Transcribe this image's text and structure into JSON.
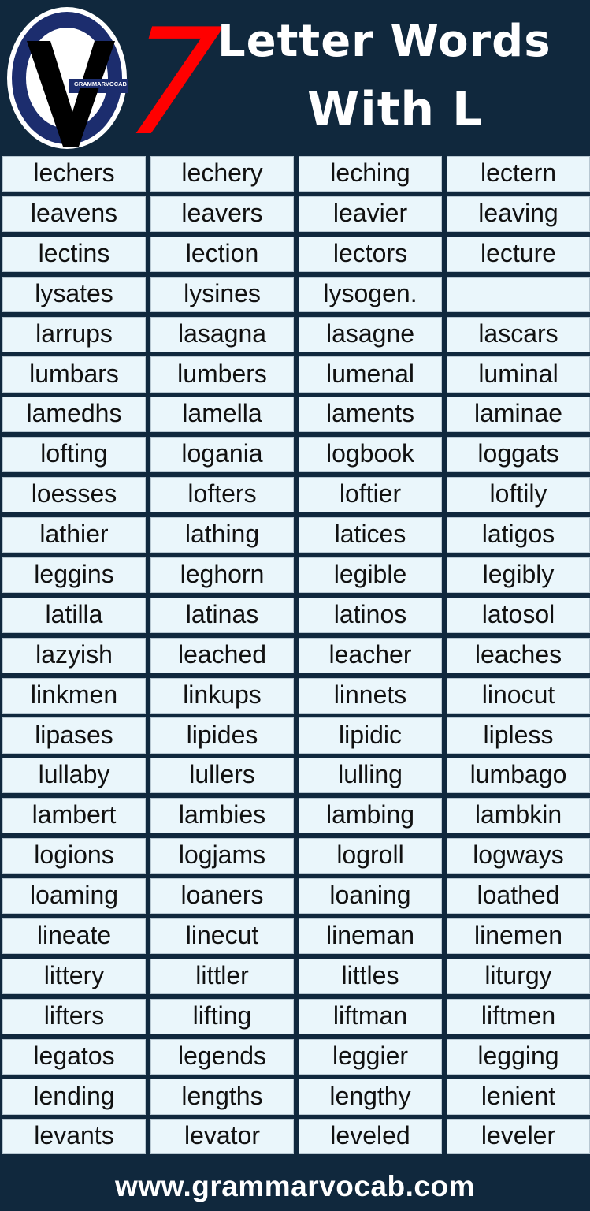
{
  "header": {
    "number": "7",
    "title_line1": "Letter Words",
    "title_line2": "With L",
    "logo_text": "GRAMMARVOCAB",
    "logo_icon": "gv-monogram-logo"
  },
  "colors": {
    "background": "#10283d",
    "accent_number": "#ff0000",
    "cell_background": "#eaf6fb",
    "logo_ring": "#1c2d6e"
  },
  "words": [
    [
      "lechers",
      "lechery",
      "leching",
      "lectern"
    ],
    [
      "leavens",
      "leavers",
      "leavier",
      "leaving"
    ],
    [
      "lectins",
      "lection",
      "lectors",
      "lecture"
    ],
    [
      "lysates",
      "lysines",
      "lysogen.",
      ""
    ],
    [
      "larrups",
      "lasagna",
      "lasagne",
      "lascars"
    ],
    [
      "lumbars",
      "lumbers",
      "lumenal",
      "luminal"
    ],
    [
      "lamedhs",
      "lamella",
      "laments",
      "laminae"
    ],
    [
      "lofting",
      "logania",
      "logbook",
      "loggats"
    ],
    [
      "loesses",
      "lofters",
      "loftier",
      "loftily"
    ],
    [
      "lathier",
      "lathing",
      "latices",
      "latigos"
    ],
    [
      "leggins",
      "leghorn",
      "legible",
      "legibly"
    ],
    [
      "latilla",
      "latinas",
      "latinos",
      "latosol"
    ],
    [
      "lazyish",
      "leached",
      "leacher",
      "leaches"
    ],
    [
      "linkmen",
      "linkups",
      "linnets",
      "linocut"
    ],
    [
      "lipases",
      "lipides",
      "lipidic",
      "lipless"
    ],
    [
      "lullaby",
      "lullers",
      "lulling",
      "lumbago"
    ],
    [
      "lambert",
      "lambies",
      "lambing",
      "lambkin"
    ],
    [
      "logions",
      "logjams",
      "logroll",
      "logways"
    ],
    [
      "loaming",
      "loaners",
      "loaning",
      "loathed"
    ],
    [
      "lineate",
      "linecut",
      "lineman",
      "linemen"
    ],
    [
      "littery",
      "littler",
      "littles",
      "liturgy"
    ],
    [
      "lifters",
      "lifting",
      "liftman",
      "liftmen"
    ],
    [
      "legatos",
      "legends",
      "leggier",
      "legging"
    ],
    [
      "lending",
      "lengths",
      "lengthy",
      "lenient"
    ],
    [
      "levants",
      "levator",
      "leveled",
      "leveler"
    ]
  ],
  "footer": {
    "url": "www.grammarvocab.com"
  }
}
